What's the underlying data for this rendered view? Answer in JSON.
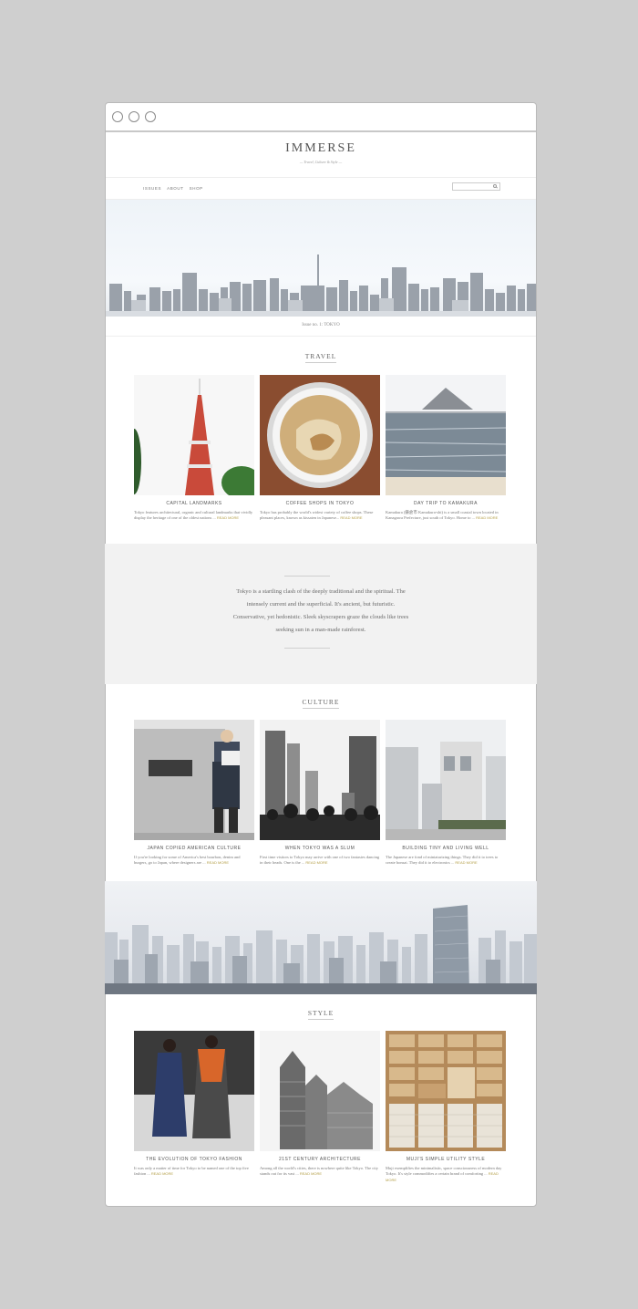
{
  "site": {
    "title": "IMMERSE",
    "tagline": "— Travel, Culture & Style —"
  },
  "nav": [
    "ISSUES",
    "ABOUT",
    "SHOP"
  ],
  "search": {
    "placeholder": ""
  },
  "issue_label": "Issue no. 1: TOKYO",
  "sections": {
    "travel": {
      "title": "TRAVEL",
      "cards": [
        {
          "title": "CAPITAL LANDMARKS",
          "text": "Tokyo features architectural, organic and cultural landmarks that vividly display the heritage of one of the oldest nations ...",
          "more": "READ MORE"
        },
        {
          "title": "COFFEE SHOPS IN TOKYO",
          "text": "Tokyo has probably the world's widest variety of coffee shops. These pleasant places, known as kissaten in Japanese...",
          "more": "READ MORE"
        },
        {
          "title": "DAY TRIP TO KAMAKURA",
          "text": "Kamakura (鎌倉市 Kamakura-shi) is a small coastal town located in Kanagawa Prefecture, just south of Tokyo. Home to ...",
          "more": "READ MORE"
        }
      ]
    },
    "quote": "Tokyo is a startling clash of the deeply traditional and the spiritual. The intensely current and the superficial. It's ancient, but futuristic. Conservative, yet hedonistic. Sleek skyscrapers graze the clouds like trees seeking sun in a man-made rainforest.",
    "culture": {
      "title": "CULTURE",
      "cards": [
        {
          "title": "JAPAN COPIED AMERICAN CULTURE",
          "text": "If you're looking for some of America's best bourbon, denim and burgers, go to Japan, where designers are ...",
          "more": "READ MORE"
        },
        {
          "title": "WHEN TOKYO WAS A SLUM",
          "text": "First time visitors to Tokyo may arrive with one of two fantasies dancing in their heads. One is the ...",
          "more": "READ MORE"
        },
        {
          "title": "BUILDING TINY AND LIVING WELL",
          "text": "The Japanese are fond of miniaturizing things. They did it to trees to create bonsai. They did it to electronics ...",
          "more": "READ MORE"
        }
      ]
    },
    "style": {
      "title": "STYLE",
      "cards": [
        {
          "title": "THE EVOLUTION OF TOKYO FASHION",
          "text": "It was only a matter of time for Tokyo to be named one of the top five fashion ...",
          "more": "READ MORE"
        },
        {
          "title": "21ST CENTURY ARCHITECTURE",
          "text": "Among all the world's cities, there is nowhere quite like Tokyo. The city stands out for its vast ...",
          "more": "READ MORE"
        },
        {
          "title": "MUJI'S SIMPLE UTILITY STYLE",
          "text": "Muji exemplifies the minimalistic, space consciousness of modern day Tokyo. It's style commodifies a certain brand of comforting ...",
          "more": "READ MORE"
        }
      ]
    }
  },
  "colors": {
    "background": "#cfcfcf",
    "accent": "#b5a04a",
    "band": "#f2f2f2"
  }
}
